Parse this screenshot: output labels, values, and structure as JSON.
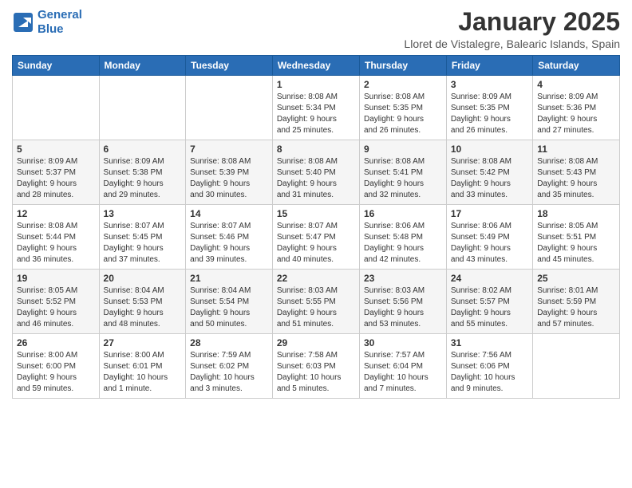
{
  "header": {
    "logo_line1": "General",
    "logo_line2": "Blue",
    "month": "January 2025",
    "location": "Lloret de Vistalegre, Balearic Islands, Spain"
  },
  "weekdays": [
    "Sunday",
    "Monday",
    "Tuesday",
    "Wednesday",
    "Thursday",
    "Friday",
    "Saturday"
  ],
  "weeks": [
    [
      {
        "day": "",
        "info": ""
      },
      {
        "day": "",
        "info": ""
      },
      {
        "day": "",
        "info": ""
      },
      {
        "day": "1",
        "info": "Sunrise: 8:08 AM\nSunset: 5:34 PM\nDaylight: 9 hours\nand 25 minutes."
      },
      {
        "day": "2",
        "info": "Sunrise: 8:08 AM\nSunset: 5:35 PM\nDaylight: 9 hours\nand 26 minutes."
      },
      {
        "day": "3",
        "info": "Sunrise: 8:09 AM\nSunset: 5:35 PM\nDaylight: 9 hours\nand 26 minutes."
      },
      {
        "day": "4",
        "info": "Sunrise: 8:09 AM\nSunset: 5:36 PM\nDaylight: 9 hours\nand 27 minutes."
      }
    ],
    [
      {
        "day": "5",
        "info": "Sunrise: 8:09 AM\nSunset: 5:37 PM\nDaylight: 9 hours\nand 28 minutes."
      },
      {
        "day": "6",
        "info": "Sunrise: 8:09 AM\nSunset: 5:38 PM\nDaylight: 9 hours\nand 29 minutes."
      },
      {
        "day": "7",
        "info": "Sunrise: 8:08 AM\nSunset: 5:39 PM\nDaylight: 9 hours\nand 30 minutes."
      },
      {
        "day": "8",
        "info": "Sunrise: 8:08 AM\nSunset: 5:40 PM\nDaylight: 9 hours\nand 31 minutes."
      },
      {
        "day": "9",
        "info": "Sunrise: 8:08 AM\nSunset: 5:41 PM\nDaylight: 9 hours\nand 32 minutes."
      },
      {
        "day": "10",
        "info": "Sunrise: 8:08 AM\nSunset: 5:42 PM\nDaylight: 9 hours\nand 33 minutes."
      },
      {
        "day": "11",
        "info": "Sunrise: 8:08 AM\nSunset: 5:43 PM\nDaylight: 9 hours\nand 35 minutes."
      }
    ],
    [
      {
        "day": "12",
        "info": "Sunrise: 8:08 AM\nSunset: 5:44 PM\nDaylight: 9 hours\nand 36 minutes."
      },
      {
        "day": "13",
        "info": "Sunrise: 8:07 AM\nSunset: 5:45 PM\nDaylight: 9 hours\nand 37 minutes."
      },
      {
        "day": "14",
        "info": "Sunrise: 8:07 AM\nSunset: 5:46 PM\nDaylight: 9 hours\nand 39 minutes."
      },
      {
        "day": "15",
        "info": "Sunrise: 8:07 AM\nSunset: 5:47 PM\nDaylight: 9 hours\nand 40 minutes."
      },
      {
        "day": "16",
        "info": "Sunrise: 8:06 AM\nSunset: 5:48 PM\nDaylight: 9 hours\nand 42 minutes."
      },
      {
        "day": "17",
        "info": "Sunrise: 8:06 AM\nSunset: 5:49 PM\nDaylight: 9 hours\nand 43 minutes."
      },
      {
        "day": "18",
        "info": "Sunrise: 8:05 AM\nSunset: 5:51 PM\nDaylight: 9 hours\nand 45 minutes."
      }
    ],
    [
      {
        "day": "19",
        "info": "Sunrise: 8:05 AM\nSunset: 5:52 PM\nDaylight: 9 hours\nand 46 minutes."
      },
      {
        "day": "20",
        "info": "Sunrise: 8:04 AM\nSunset: 5:53 PM\nDaylight: 9 hours\nand 48 minutes."
      },
      {
        "day": "21",
        "info": "Sunrise: 8:04 AM\nSunset: 5:54 PM\nDaylight: 9 hours\nand 50 minutes."
      },
      {
        "day": "22",
        "info": "Sunrise: 8:03 AM\nSunset: 5:55 PM\nDaylight: 9 hours\nand 51 minutes."
      },
      {
        "day": "23",
        "info": "Sunrise: 8:03 AM\nSunset: 5:56 PM\nDaylight: 9 hours\nand 53 minutes."
      },
      {
        "day": "24",
        "info": "Sunrise: 8:02 AM\nSunset: 5:57 PM\nDaylight: 9 hours\nand 55 minutes."
      },
      {
        "day": "25",
        "info": "Sunrise: 8:01 AM\nSunset: 5:59 PM\nDaylight: 9 hours\nand 57 minutes."
      }
    ],
    [
      {
        "day": "26",
        "info": "Sunrise: 8:00 AM\nSunset: 6:00 PM\nDaylight: 9 hours\nand 59 minutes."
      },
      {
        "day": "27",
        "info": "Sunrise: 8:00 AM\nSunset: 6:01 PM\nDaylight: 10 hours\nand 1 minute."
      },
      {
        "day": "28",
        "info": "Sunrise: 7:59 AM\nSunset: 6:02 PM\nDaylight: 10 hours\nand 3 minutes."
      },
      {
        "day": "29",
        "info": "Sunrise: 7:58 AM\nSunset: 6:03 PM\nDaylight: 10 hours\nand 5 minutes."
      },
      {
        "day": "30",
        "info": "Sunrise: 7:57 AM\nSunset: 6:04 PM\nDaylight: 10 hours\nand 7 minutes."
      },
      {
        "day": "31",
        "info": "Sunrise: 7:56 AM\nSunset: 6:06 PM\nDaylight: 10 hours\nand 9 minutes."
      },
      {
        "day": "",
        "info": ""
      }
    ]
  ]
}
